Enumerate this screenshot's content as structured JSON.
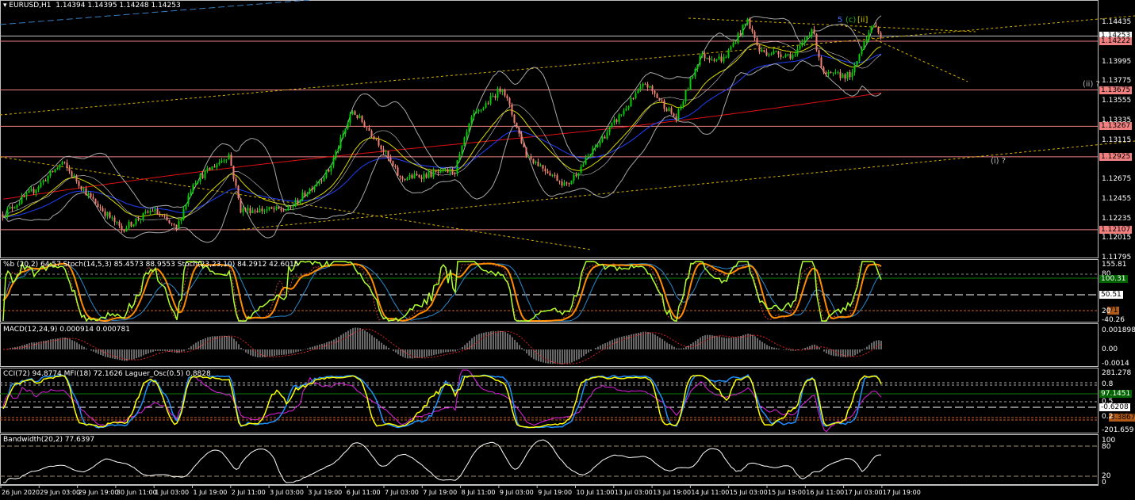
{
  "header": {
    "symbol_label": "EURUSD,H1",
    "ohlc": "1.14394 1.14395 1.14248 1.14253"
  },
  "colors": {
    "bull": "#00d000",
    "bear": "#f08070",
    "level_line": "#f08080",
    "ma200": "#e01010",
    "ma_fast": "#d8d800",
    "ma_mid": "#2040ff",
    "bands": "#a8a8a8",
    "trend": "#d4b000"
  },
  "price_axis": {
    "ticks": [
      "1.14435",
      "1.13995",
      "1.13775",
      "1.13555",
      "1.13335",
      "1.13115",
      "1.12675",
      "1.12455",
      "1.12235",
      "1.12015",
      "1.11795"
    ],
    "current_price": "1.14253",
    "levels": [
      "1.14222",
      "1.13675",
      "1.13267",
      "1.12925",
      "1.12107"
    ]
  },
  "wave_labels": {
    "w5": "5",
    "wc": "(c)",
    "wii": "[ii]",
    "ii_q": "(ii) ?",
    "i_q": "(i) ?"
  },
  "indicators": {
    "stoch_pane": {
      "title": "%b (20,2) 64.57  Stoch(14,5,3) 85.4573 88.9553  Stoch(23,23,10) 84.2912 42.6015",
      "max": "155.81",
      "l80": "80",
      "pb_value": "100.31",
      "mid": "50.51",
      "l20": "20",
      "stoch_tag": "71",
      "min": "-40.26"
    },
    "macd_pane": {
      "title": "MACD(12,24,9) 0.000914 0.000781",
      "max": "0.001898",
      "zero": "0.00",
      "min": "-0.0014"
    },
    "cci_pane": {
      "title": "CCI(72) 94.8774  MFI(18) 72.1626  Laguer_Osc(0.5) 0.8828",
      "max": "281.278",
      "l08": "0.8",
      "cci_tag": "97.1451",
      "l05": "0.5",
      "mid_tag": "-0.6208",
      "l02": "0.2",
      "mfi_tag": "3.3867",
      "min": "-201.659"
    },
    "bw_pane": {
      "title": "Bandwidth(20,2) 77.6397",
      "max": "100",
      "l80": "80",
      "l20": "20",
      "min": "0"
    }
  },
  "time_axis": [
    "26 Jun 2020",
    "29 Jun 03:00",
    "29 Jun 19:00",
    "30 Jun 11:00",
    "1 Jul 03:00",
    "1 Jul 19:00",
    "2 Jul 11:00",
    "3 Jul 03:00",
    "3 Jul 19:00",
    "6 Jul 11:00",
    "7 Jul 03:00",
    "7 Jul 19:00",
    "8 Jul 11:00",
    "9 Jul 03:00",
    "9 Jul 19:00",
    "10 Jul 11:00",
    "13 Jul 03:00",
    "13 Jul 19:00",
    "14 Jul 11:00",
    "15 Jul 03:00",
    "15 Jul 19:00",
    "16 Jul 11:00",
    "17 Jul 03:00",
    "17 Jul 19:00"
  ],
  "chart_data": {
    "type": "candlestick",
    "title": "EURUSD,H1",
    "ylim": [
      1.11795,
      1.14435
    ],
    "price_path_hour_price": [
      [
        0,
        1.1228
      ],
      [
        13,
        1.1255
      ],
      [
        25,
        1.1286
      ],
      [
        37,
        1.1246
      ],
      [
        50,
        1.1211
      ],
      [
        63,
        1.1233
      ],
      [
        73,
        1.1211
      ],
      [
        80,
        1.1264
      ],
      [
        95,
        1.1295
      ],
      [
        100,
        1.1233
      ],
      [
        120,
        1.1233
      ],
      [
        137,
        1.1277
      ],
      [
        147,
        1.1344
      ],
      [
        157,
        1.1313
      ],
      [
        167,
        1.1268
      ],
      [
        190,
        1.1277
      ],
      [
        197,
        1.1335
      ],
      [
        210,
        1.1371
      ],
      [
        220,
        1.1295
      ],
      [
        237,
        1.126
      ],
      [
        253,
        1.1317
      ],
      [
        270,
        1.1375
      ],
      [
        283,
        1.1335
      ],
      [
        293,
        1.1406
      ],
      [
        303,
        1.1402
      ],
      [
        313,
        1.1446
      ],
      [
        318,
        1.1411
      ],
      [
        333,
        1.1406
      ],
      [
        340,
        1.1437
      ],
      [
        345,
        1.1384
      ],
      [
        357,
        1.1384
      ],
      [
        362,
        1.1424
      ],
      [
        367,
        1.1442
      ],
      [
        369,
        1.14253
      ]
    ]
  }
}
